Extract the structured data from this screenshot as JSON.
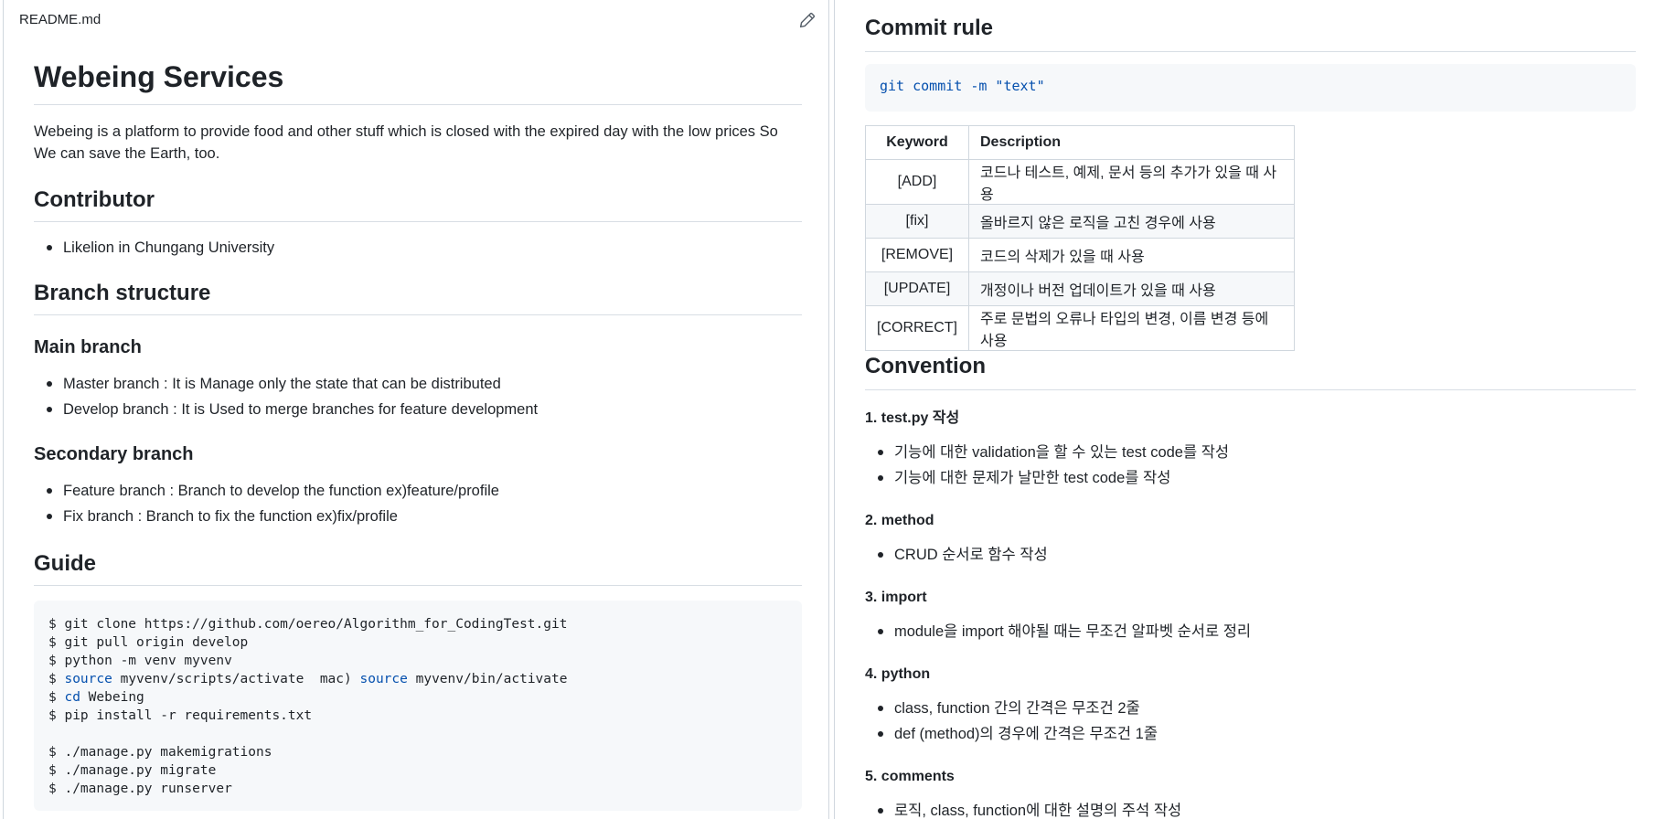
{
  "left": {
    "file_name": "README.md",
    "title": "Webeing Services",
    "intro": "Webeing is a platform to provide food and other stuff which is closed with the expired day with the low prices So We can save the Earth, too.",
    "contributor": {
      "heading": "Contributor",
      "items": [
        "Likelion in Chungang University"
      ]
    },
    "branch": {
      "heading": "Branch structure",
      "main_heading": "Main branch",
      "main_items": [
        "Master branch : It is Manage only the state that can be distributed",
        "Develop branch : It is Used to merge branches for feature development"
      ],
      "secondary_heading": "Secondary branch",
      "secondary_items": [
        "Feature branch : Branch to develop the function ex)feature/profile",
        "Fix branch : Branch to fix the function ex)fix/profile"
      ]
    },
    "guide": {
      "heading": "Guide",
      "lines": [
        {
          "prefix": "$ ",
          "kw": "",
          "rest": "git clone https://github.com/oereo/Algorithm_for_CodingTest.git"
        },
        {
          "prefix": "$ ",
          "kw": "",
          "rest": "git pull origin develop"
        },
        {
          "prefix": "$ ",
          "kw": "",
          "rest": "python -m venv myvenv"
        },
        {
          "prefix": "$ ",
          "kw": "source",
          "rest": " myvenv/scripts/activate  mac) ",
          "kw2": "source",
          "rest2": " myvenv/bin/activate"
        },
        {
          "prefix": "$ ",
          "kw": "cd",
          "rest": " Webeing"
        },
        {
          "prefix": "$ ",
          "kw": "",
          "rest": "pip install -r requirements.txt"
        },
        {
          "prefix": "",
          "kw": "",
          "rest": ""
        },
        {
          "prefix": "$ ",
          "kw": "",
          "rest": "./manage.py makemigrations"
        },
        {
          "prefix": "$ ",
          "kw": "",
          "rest": "./manage.py migrate"
        },
        {
          "prefix": "$ ",
          "kw": "",
          "rest": "./manage.py runserver"
        }
      ]
    }
  },
  "right": {
    "commit_heading": "Commit rule",
    "commit_code": "git commit -m \"text\"",
    "table": {
      "headers": [
        "Keyword",
        "Description"
      ],
      "rows": [
        [
          "[ADD]",
          "코드나 테스트, 예제, 문서 등의 추가가 있을 때 사용"
        ],
        [
          "[fix]",
          "올바르지 않은 로직을 고친 경우에 사용"
        ],
        [
          "[REMOVE]",
          "코드의 삭제가 있을 때 사용"
        ],
        [
          "[UPDATE]",
          "개정이나 버전 업데이트가 있을 때 사용"
        ],
        [
          "[CORRECT]",
          "주로 문법의 오류나 타입의 변경, 이름 변경 등에 사용"
        ]
      ]
    },
    "convention_heading": "Convention",
    "sections": [
      {
        "title": "1. test.py 작성",
        "items": [
          "기능에 대한 validation을 할 수 있는 test code를 작성",
          "기능에 대한 문제가 날만한 test code를 작성"
        ]
      },
      {
        "title": "2. method",
        "items": [
          "CRUD 순서로 함수 작성"
        ]
      },
      {
        "title": "3. import",
        "items": [
          "module을 import 해야될 때는 무조건 알파벳 순서로 정리"
        ]
      },
      {
        "title": "4. python",
        "items": [
          "class, function 간의 간격은 무조건 2줄",
          "def (method)의 경우에 간격은 무조건 1줄"
        ]
      },
      {
        "title": "5. comments",
        "items": [
          "로직, class, function에 대한 설명의 주석 작성"
        ]
      }
    ]
  }
}
